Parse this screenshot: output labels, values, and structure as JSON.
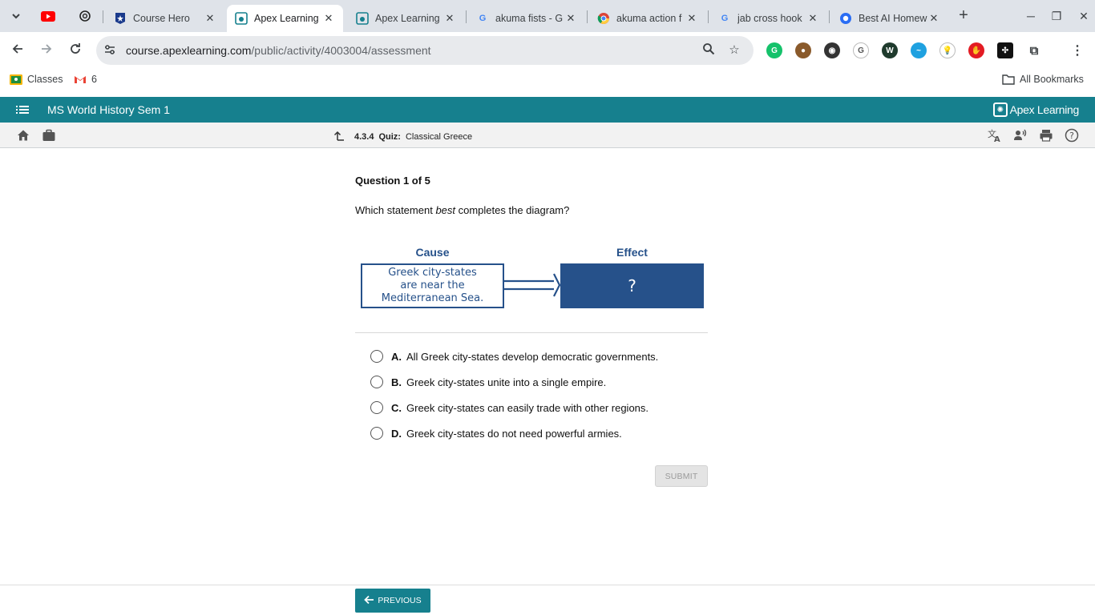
{
  "browser": {
    "tabs": [
      {
        "title": "Course Hero",
        "favicon": "course-hero"
      },
      {
        "title": "Apex Learning",
        "favicon": "apex",
        "active": true
      },
      {
        "title": "Apex Learning",
        "favicon": "apex"
      },
      {
        "title": "akuma fists - G",
        "favicon": "google"
      },
      {
        "title": "akuma action f",
        "favicon": "chrome"
      },
      {
        "title": "jab cross hook",
        "favicon": "google"
      },
      {
        "title": "Best AI Homew",
        "favicon": "q"
      }
    ],
    "url_host": "course.apexlearning.com",
    "url_path": "/public/activity/4003004/assessment",
    "bookmarks": {
      "classes": "Classes",
      "gmail_count": "6",
      "all_bookmarks": "All Bookmarks"
    }
  },
  "apex": {
    "course_title": "MS World History Sem 1",
    "logo_text": "Apex Learning",
    "breadcrumb": {
      "number": "4.3.4",
      "type": "Quiz:",
      "title": "Classical Greece"
    }
  },
  "question": {
    "counter": "Question 1 of 5",
    "prompt_before": "Which statement ",
    "prompt_emphasis": "best",
    "prompt_after": " completes the diagram?",
    "diagram": {
      "cause_label": "Cause",
      "effect_label": "Effect",
      "cause_line1": "Greek city-states",
      "cause_line2": "are near the",
      "cause_line3": "Mediterranean Sea.",
      "effect_text": "?"
    },
    "choices": [
      {
        "letter": "A.",
        "text": "All Greek city-states develop democratic governments."
      },
      {
        "letter": "B.",
        "text": "Greek city-states unite into a single empire."
      },
      {
        "letter": "C.",
        "text": "Greek city-states can easily trade with other regions."
      },
      {
        "letter": "D.",
        "text": "Greek city-states do not need powerful armies."
      }
    ],
    "submit_label": "SUBMIT"
  },
  "footer": {
    "previous_label": "PREVIOUS"
  },
  "colors": {
    "apex_teal": "#16808e",
    "diagram_blue": "#26518a"
  }
}
